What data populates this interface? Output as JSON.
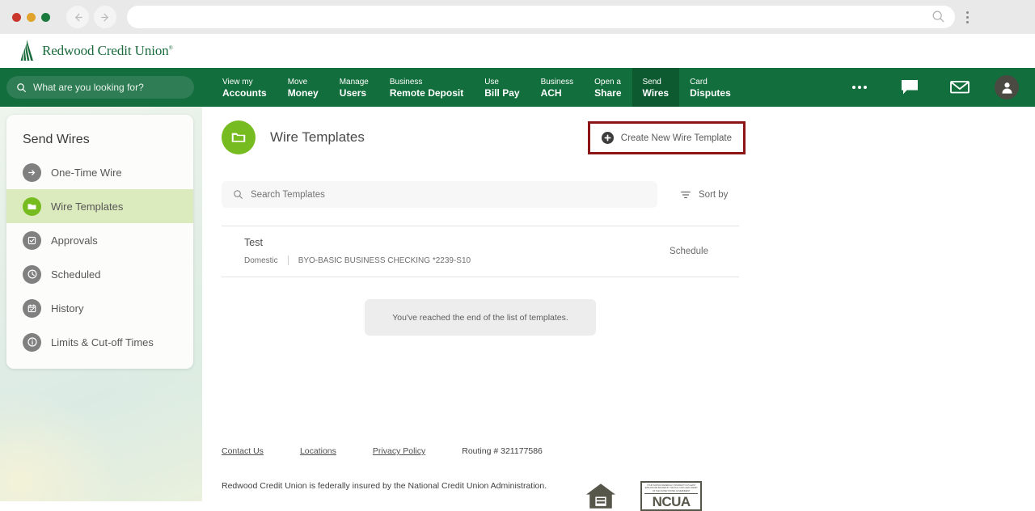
{
  "browser": {
    "url_value": "",
    "url_placeholder": "",
    "back_icon": "back-arrow-icon",
    "forward_icon": "forward-arrow-icon",
    "search_icon": "search-icon",
    "menu_icon": "kebab-menu-icon"
  },
  "site_header": {
    "logo_text": "Redwood Credit Union",
    "logo_tm": "®",
    "logo_icon": "redwood-tree-logo"
  },
  "top_nav": {
    "search_placeholder": "What are you looking for?",
    "search_icon": "search-icon",
    "items": [
      {
        "top": "View my",
        "bottom": "Accounts",
        "active": false
      },
      {
        "top": "Move",
        "bottom": "Money",
        "active": false
      },
      {
        "top": "Manage",
        "bottom": "Users",
        "active": false
      },
      {
        "top": "Business",
        "bottom": "Remote Deposit",
        "active": false
      },
      {
        "top": "Use",
        "bottom": "Bill Pay",
        "active": false
      },
      {
        "top": "Business",
        "bottom": "ACH",
        "active": false
      },
      {
        "top": "Open a",
        "bottom": "Share",
        "active": false
      },
      {
        "top": "Send",
        "bottom": "Wires",
        "active": true
      },
      {
        "top": "Card",
        "bottom": "Disputes",
        "active": false
      }
    ],
    "more_icon": "ellipsis-icon",
    "chat_icon": "chat-bubble-icon",
    "mail_icon": "envelope-icon",
    "profile_icon": "user-avatar-icon"
  },
  "sidebar": {
    "title": "Send Wires",
    "items": [
      {
        "label": "One-Time Wire",
        "icon": "arrow-right-icon",
        "active": false
      },
      {
        "label": "Wire Templates",
        "icon": "folder-icon",
        "active": true
      },
      {
        "label": "Approvals",
        "icon": "check-circle-icon",
        "active": false
      },
      {
        "label": "Scheduled",
        "icon": "clock-icon",
        "active": false
      },
      {
        "label": "History",
        "icon": "calendar-check-icon",
        "active": false
      },
      {
        "label": "Limits & Cut-off Times",
        "icon": "info-icon",
        "active": false
      }
    ]
  },
  "main": {
    "page_icon": "folder-icon",
    "page_title": "Wire Templates",
    "create_button": {
      "label": "Create New Wire Template",
      "icon": "plus-circle-icon",
      "highlight_color": "#8c1616"
    },
    "search": {
      "placeholder": "Search Templates",
      "icon": "search-icon"
    },
    "sort": {
      "label": "Sort by",
      "icon": "filter-icon"
    },
    "templates": [
      {
        "name": "Test",
        "type": "Domestic",
        "account": "BYO-BASIC BUSINESS CHECKING *2239-S10",
        "action": "Schedule"
      }
    ],
    "end_of_list_message": "You've reached the end of the list of templates."
  },
  "footer": {
    "links": [
      {
        "label": "Contact Us"
      },
      {
        "label": "Locations"
      },
      {
        "label": "Privacy Policy"
      }
    ],
    "routing": "Routing # 321177586",
    "disclaimer": "Redwood Credit Union is federally insured by the National Credit Union Administration.",
    "badges": {
      "equal_housing_icon": "equal-housing-lender-icon",
      "ncua_fine_print": "YOUR SAVINGS FEDERALLY INSURED TO AT LEAST $250,000 AND BACKED BY THE FULL FAITH AND CREDIT OF THE UNITED STATES GOVERNMENT",
      "ncua_word": "NCUA"
    }
  },
  "colors": {
    "brand_green": "#126e3c",
    "accent_green": "#76bc21",
    "active_nav": "#0d5a30",
    "sidebar_active": "#dcebbe",
    "annotation_red": "#8c1616"
  }
}
